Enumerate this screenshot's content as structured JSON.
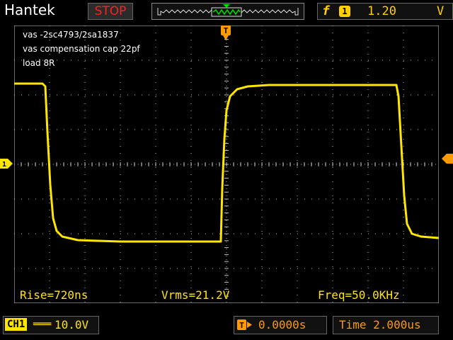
{
  "header": {
    "brand": "Hantek",
    "run_state": "STOP",
    "trigger": {
      "slope_symbol": "f",
      "source": "1",
      "level": "1.20",
      "unit": "V"
    }
  },
  "notes": [
    "vas -2sc4793/2sa1837",
    "vas compensation cap 22pf",
    "load 8R"
  ],
  "measurements": {
    "rise": "Rise=720ns",
    "vrms": "Vrms=21.2V",
    "freq": "Freq=50.0KHz"
  },
  "channel": {
    "label": "CH1",
    "coupling_symbol": "═══",
    "volts_div": "10.0V"
  },
  "trigger_position": {
    "value": "0.0000s"
  },
  "timebase": {
    "value": "Time 2.000us"
  },
  "markers": {
    "channel_marker": "1",
    "trigger_time_marker": "T"
  },
  "colors": {
    "trace": "#ffe600",
    "grid": "#bfbfbf",
    "accent_orange": "#ff9a00",
    "stop_red": "#ff2020"
  }
}
